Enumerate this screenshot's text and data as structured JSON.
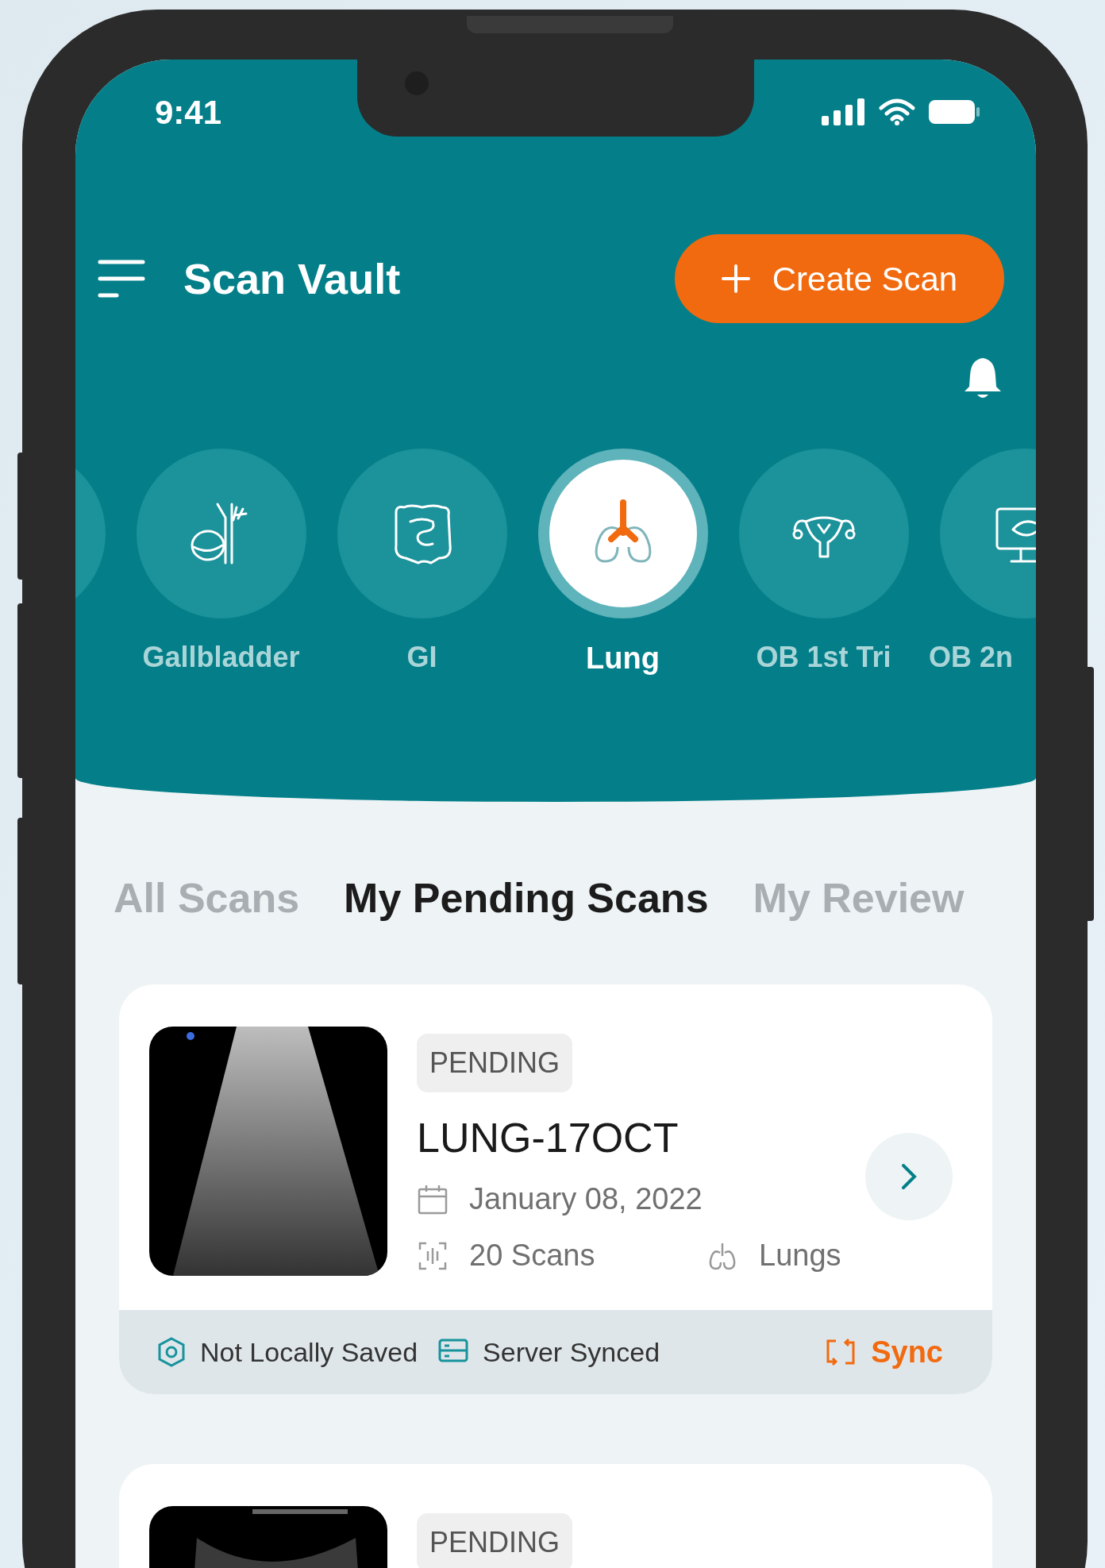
{
  "status_bar": {
    "time": "9:41"
  },
  "header": {
    "title": "Scan Vault",
    "create_button": "Create Scan"
  },
  "categories": [
    {
      "label": "Gallbladder",
      "kind": "gallbladder",
      "selected": false
    },
    {
      "label": "GI",
      "kind": "intestine",
      "selected": false
    },
    {
      "label": "Lung",
      "kind": "lungs",
      "selected": true
    },
    {
      "label": "OB 1st Tri",
      "kind": "uterus",
      "selected": false
    },
    {
      "label": "OB 2n",
      "kind": "monitor",
      "selected": false
    }
  ],
  "tabs": [
    {
      "label": "All Scans",
      "selected": false
    },
    {
      "label": "My Pending Scans",
      "selected": true
    },
    {
      "label": "My Review",
      "selected": false
    }
  ],
  "scans": [
    {
      "status": "PENDING",
      "title": "LUNG-17OCT",
      "date": "January 08, 2022",
      "count": "20 Scans",
      "organ": "Lungs",
      "local": "Not Locally Saved",
      "server": "Server Synced",
      "sync": "Sync"
    },
    {
      "status": "PENDING"
    }
  ]
}
